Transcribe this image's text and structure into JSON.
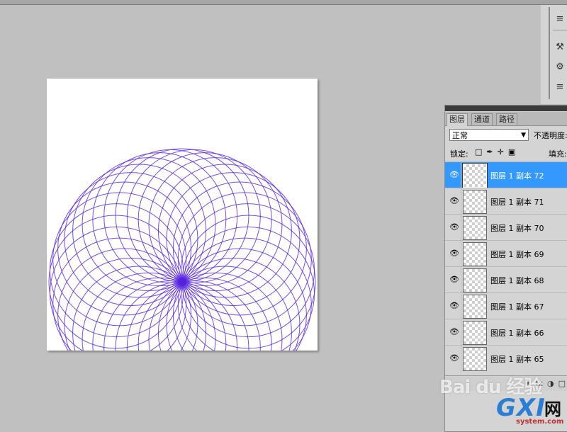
{
  "layers_panel": {
    "tabs": [
      "图层",
      "通道",
      "路径"
    ],
    "blend_mode": "正常",
    "opacity_label": "不透明度:",
    "lock_label": "锁定:",
    "fill_label": "填充:",
    "layers": [
      {
        "name": "图层 1 副本 72",
        "selected": true
      },
      {
        "name": "图层 1 副本 71",
        "selected": false
      },
      {
        "name": "图层 1 副本 70",
        "selected": false
      },
      {
        "name": "图层 1 副本 69",
        "selected": false
      },
      {
        "name": "图层 1 副本 68",
        "selected": false
      },
      {
        "name": "图层 1 副本 67",
        "selected": false
      },
      {
        "name": "图层 1 副本 66",
        "selected": false
      },
      {
        "name": "图层 1 副本 65",
        "selected": false
      }
    ]
  },
  "canvas": {
    "stroke_color": "#5522dd",
    "ring_count": 36
  },
  "watermarks": {
    "baidu": "Bai du 经验",
    "site_logo": "GXI",
    "site_logo_cn": "网",
    "site_domain": "system.com"
  },
  "colors": {
    "workspace": "#c0c0c0",
    "panel": "#d4d4d4",
    "selection": "#3399ff"
  }
}
